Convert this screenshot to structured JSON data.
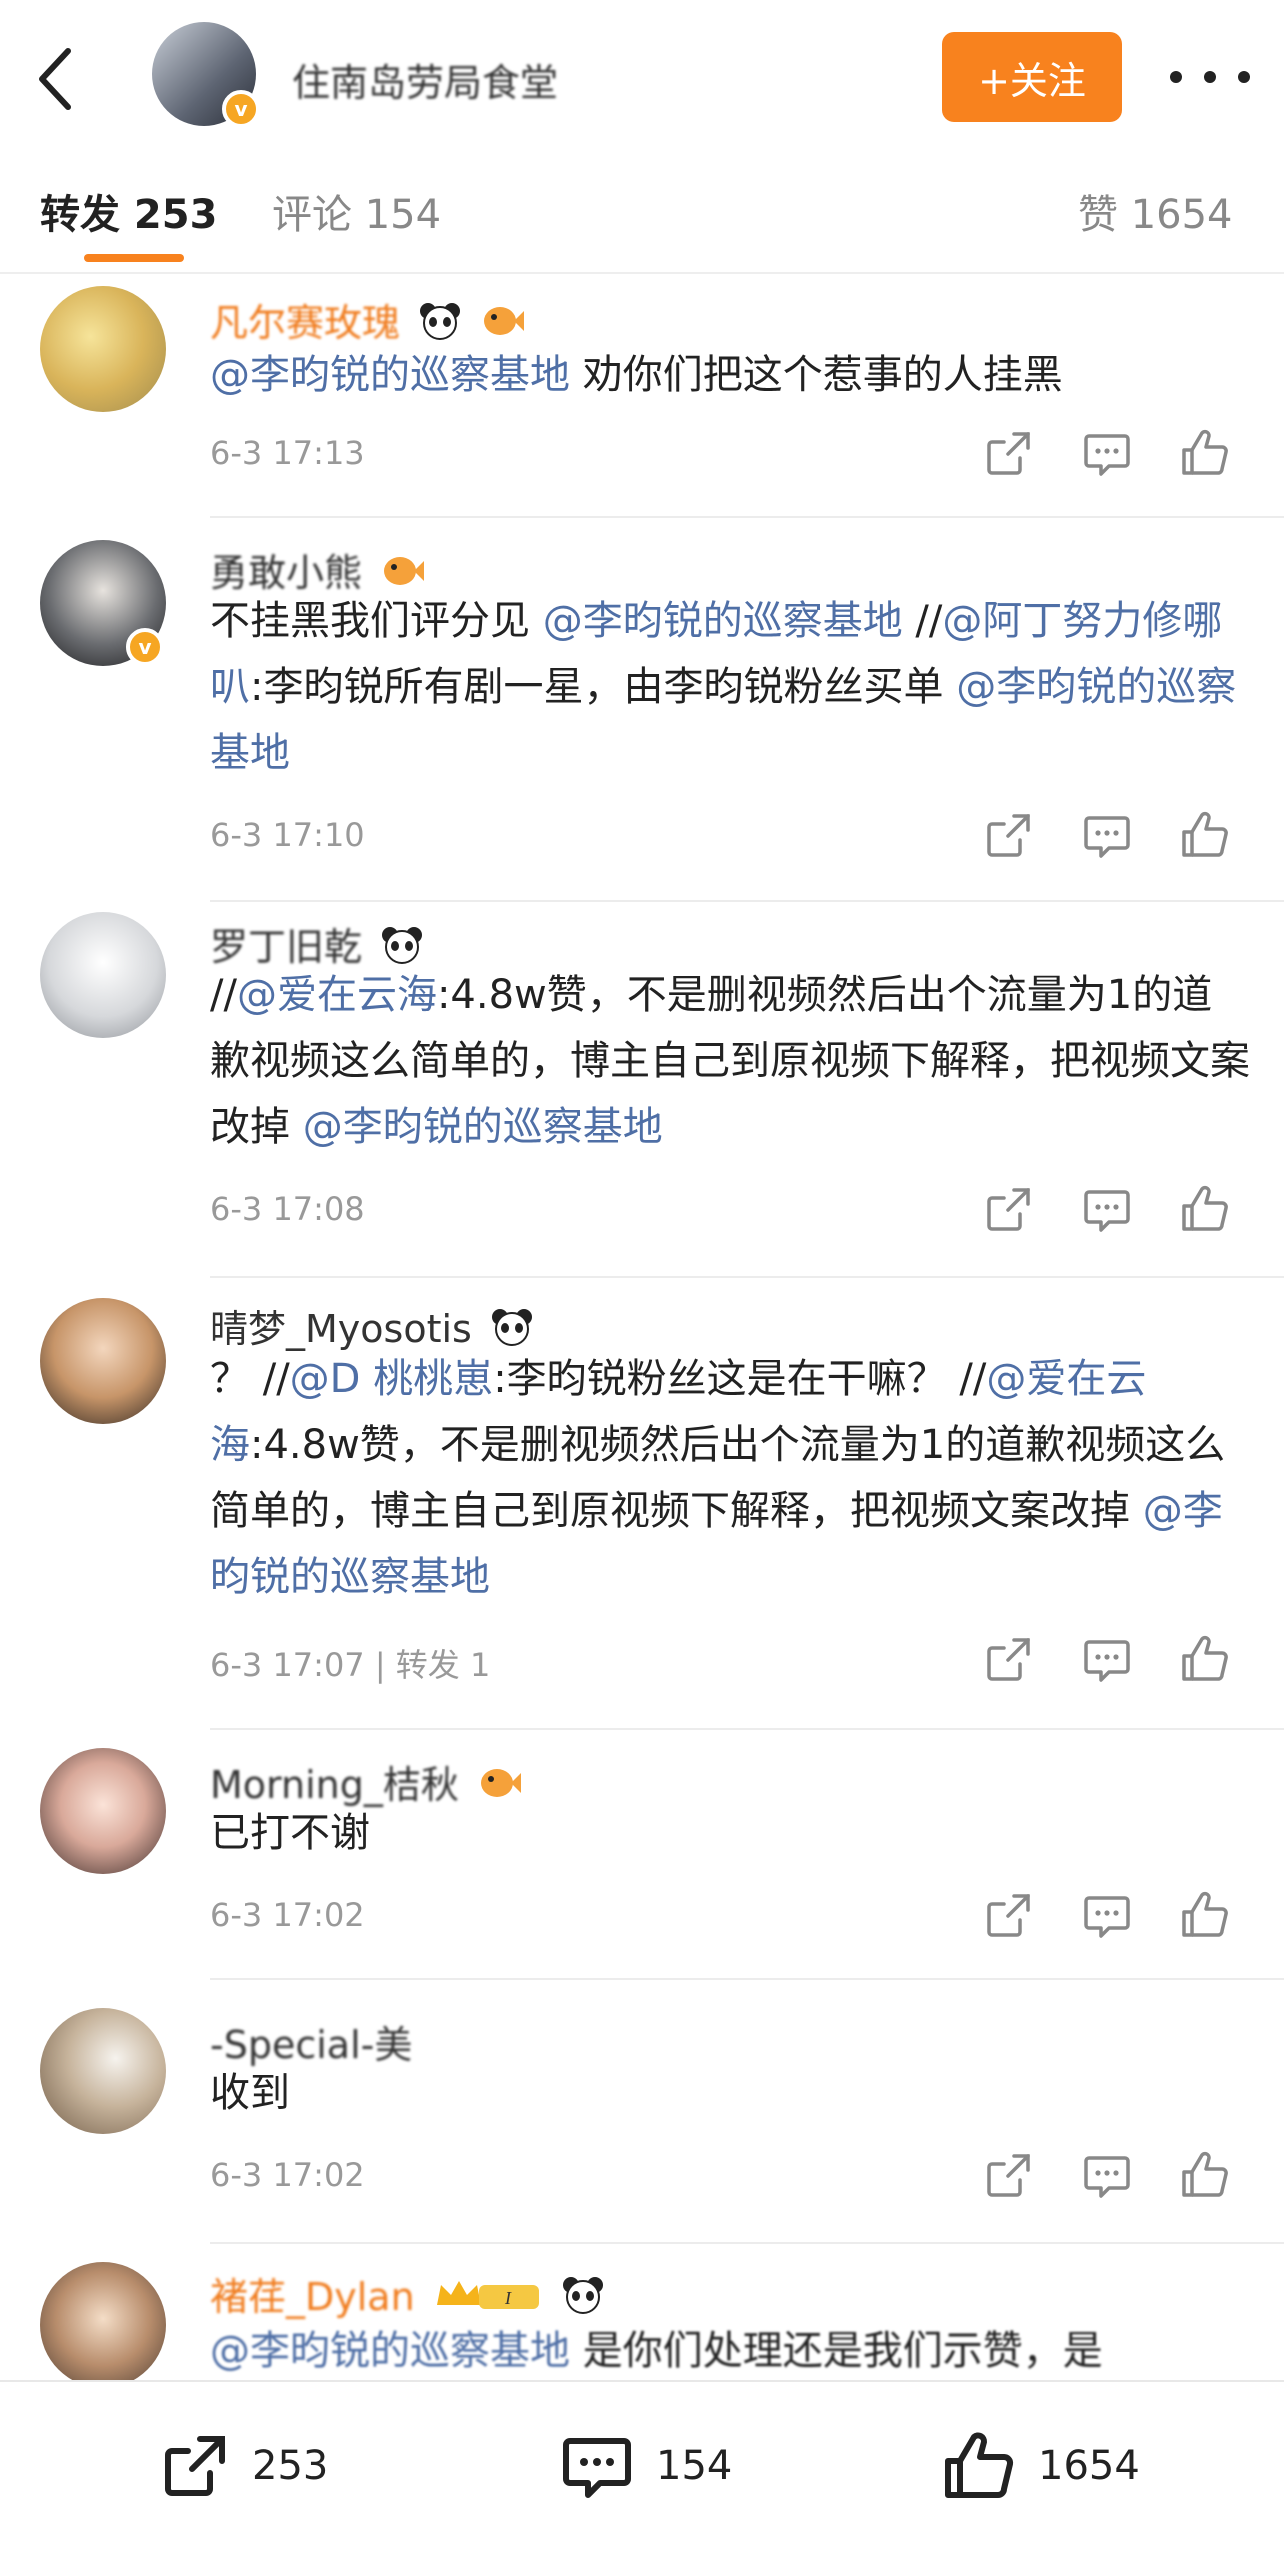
{
  "header": {
    "title_obscured": "住南岛劳局食堂",
    "follow_label": "+关注"
  },
  "tabs": [
    {
      "label": "转发 253",
      "active": true
    },
    {
      "label": "评论 154",
      "active": false
    },
    {
      "label": "赞 1654",
      "active": false
    }
  ],
  "reposts": [
    {
      "name": "凡尔赛玫瑰",
      "blurred_name": true,
      "segments": [
        {
          "t": "@李昀锐的巡察基地",
          "m": true
        },
        {
          "t": " 劝你们把这个惹事的人挂黑",
          "m": false
        }
      ],
      "time": "6-3 17:13",
      "extra": ""
    },
    {
      "name": "勇敢小熊",
      "blurred_name": true,
      "segments": [
        {
          "t": "不挂黑我们评分见 ",
          "m": false
        },
        {
          "t": "@李昀锐的巡察基地",
          "m": true
        },
        {
          "t": " //",
          "m": false
        },
        {
          "t": "@阿丁努力修哪叭",
          "m": true
        },
        {
          "t": ":李昀锐所有剧一星，由李昀锐粉丝买单 ",
          "m": false
        },
        {
          "t": "@李昀锐的巡察基地",
          "m": true
        }
      ],
      "time": "6-3 17:10",
      "extra": ""
    },
    {
      "name": "罗丁旧乾",
      "blurred_name": true,
      "segments": [
        {
          "t": "//",
          "m": false
        },
        {
          "t": "@爱在云海",
          "m": true
        },
        {
          "t": ":4.8w赞，不是删视频然后出个流量为1的道歉视频这么简单的，博主自己到原视频下解释，把视频文案改掉 ",
          "m": false
        },
        {
          "t": "@李昀锐的巡察基地",
          "m": true
        }
      ],
      "time": "6-3 17:08",
      "extra": ""
    },
    {
      "name": "晴梦_Myosotis",
      "blurred_name": false,
      "segments": [
        {
          "t": "？ //",
          "m": false
        },
        {
          "t": "@D 桃桃崽",
          "m": true
        },
        {
          "t": ":李昀锐粉丝这是在干嘛？ //",
          "m": false
        },
        {
          "t": "@爱在云海",
          "m": true
        },
        {
          "t": ":4.8w赞，不是删视频然后出个流量为1的道歉视频这么简单的，博主自己到原视频下解释，把视频文案改掉 ",
          "m": false
        },
        {
          "t": "@李昀锐的巡察基地",
          "m": true
        }
      ],
      "time": "6-3 17:07",
      "extra": " | 转发 1"
    },
    {
      "name": "Morning_桔秋",
      "blurred_name": true,
      "segments": [
        {
          "t": "已打不谢",
          "m": false
        }
      ],
      "time": "6-3 17:02",
      "extra": ""
    },
    {
      "name": "-Special-美",
      "blurred_name": true,
      "segments": [
        {
          "t": "收到",
          "m": false
        }
      ],
      "time": "6-3 17:02",
      "extra": ""
    },
    {
      "name": "褚荏_Dylan",
      "blurred_name": true,
      "segments": [
        {
          "t": "@李昀锐的巡察基地",
          "m": true
        },
        {
          "t": " 是你们处理还是我们示赞，是",
          "m": false
        }
      ],
      "time": "",
      "extra": ""
    }
  ],
  "bottom": {
    "repost_count": "253",
    "comment_count": "154",
    "like_count": "1654"
  },
  "colors": {
    "accent": "#f8821e",
    "mention": "#4f6fa6"
  }
}
